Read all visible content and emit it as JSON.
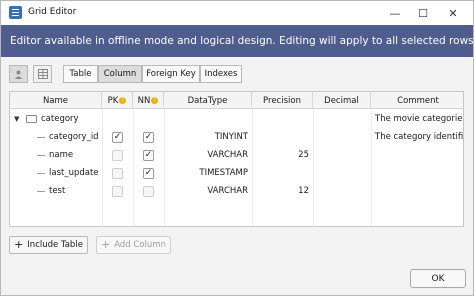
{
  "window": {
    "title": "Grid Editor",
    "minimize_glyph": "—",
    "maximize_glyph": "☐",
    "close_glyph": "✕"
  },
  "banner": {
    "text": "Editor available in offline mode and logical design. Editing will apply to all selected rows."
  },
  "toolbar": {
    "tabs": [
      "Table",
      "Column",
      "Foreign Key",
      "Indexes"
    ],
    "active_tab": "Column"
  },
  "grid": {
    "headers": {
      "name": "Name",
      "pk": "PK",
      "nn": "NN",
      "datatype": "DataType",
      "precision": "Precision",
      "decimal": "Decimal",
      "comment": "Comment"
    },
    "table_row": {
      "name": "category",
      "comment": "The movie categories"
    },
    "rows": [
      {
        "name": "category_id",
        "pk": true,
        "nn": true,
        "datatype": "TINYINT",
        "precision": "",
        "decimal": "",
        "comment": "The category identifi…"
      },
      {
        "name": "name",
        "pk": false,
        "nn": true,
        "datatype": "VARCHAR",
        "precision": "25",
        "decimal": "",
        "comment": ""
      },
      {
        "name": "last_update",
        "pk": false,
        "nn": true,
        "datatype": "TIMESTAMP",
        "precision": "",
        "decimal": "",
        "comment": ""
      },
      {
        "name": "test",
        "pk": false,
        "nn": false,
        "datatype": "VARCHAR",
        "precision": "12",
        "decimal": "",
        "comment": ""
      }
    ]
  },
  "buttons": {
    "include_table": "Include Table",
    "add_column": "Add Column",
    "ok": "OK"
  },
  "colors": {
    "banner_bg": "#4e5d8e",
    "banner_text": "#ffffff",
    "warning": "#e8b400"
  }
}
